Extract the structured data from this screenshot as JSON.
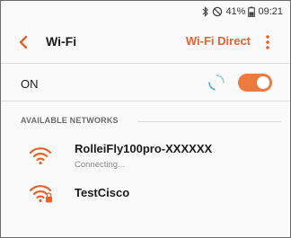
{
  "status_bar": {
    "bluetooth_icon": "bluetooth-icon",
    "dnd_icon": "do-not-disturb-icon",
    "battery_percent": "41%",
    "battery_icon": "battery-icon",
    "time": "09:21"
  },
  "action_bar": {
    "back_icon": "back-arrow-icon",
    "title": "Wi-Fi",
    "wifi_direct_label": "Wi-Fi Direct",
    "more_icon": "more-vertical-icon"
  },
  "wifi_toggle": {
    "label": "ON",
    "state": "on",
    "scanning": true
  },
  "available_networks": {
    "header": "AVAILABLE NETWORKS",
    "items": [
      {
        "name": "RolleiFly100pro-XXXXXX",
        "status": "Connecting...",
        "icon": "wifi-signal-icon",
        "secured": false
      },
      {
        "name": "TestCisco",
        "status": "",
        "icon": "wifi-locked-icon",
        "secured": true
      }
    ]
  },
  "colors": {
    "accent": "#e8612c",
    "toggle": "#ed7a3e",
    "text": "#1a1a1a",
    "secondary_text": "#8a8a8a"
  }
}
